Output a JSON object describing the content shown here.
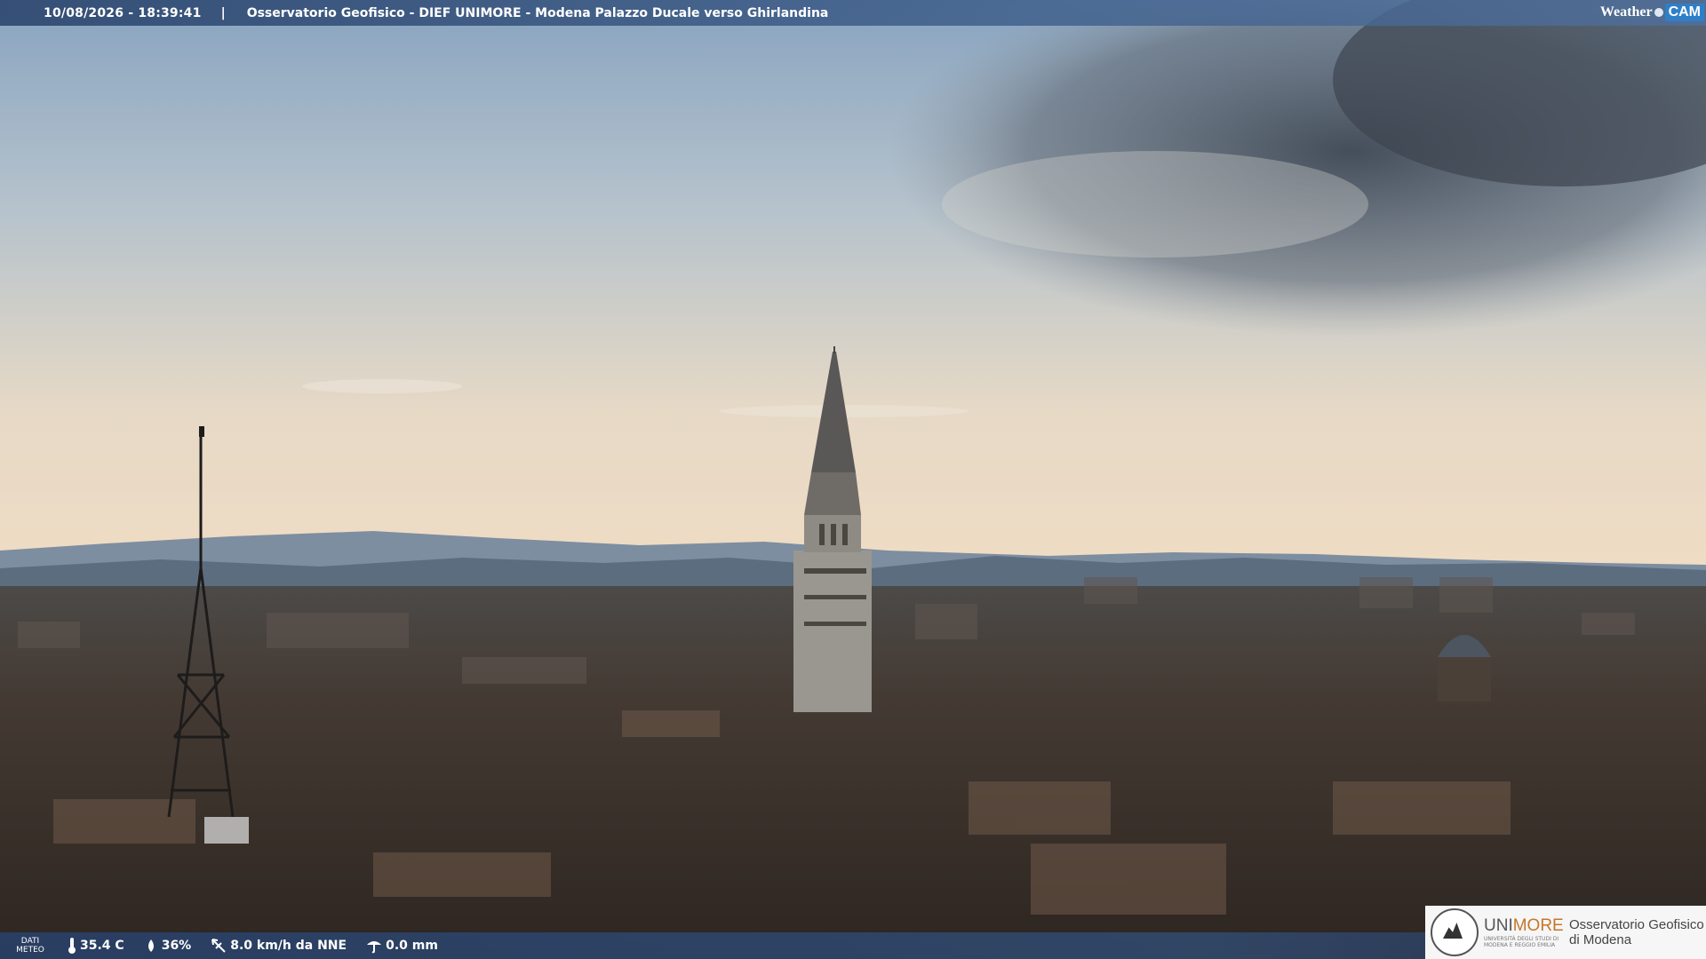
{
  "header": {
    "timestamp": "10/08/2026 - 18:39:41",
    "separator": "|",
    "title": "Osservatorio Geofisico - DIEF UNIMORE - Modena Palazzo Ducale verso Ghirlandina"
  },
  "weathercam_logo": {
    "weather": "Weather",
    "cam": "CAM"
  },
  "weather": {
    "label_line1": "DATI",
    "label_line2": "METEO",
    "temperature": "35.4 C",
    "humidity": "36%",
    "wind": "8.0 km/h da NNE",
    "rain": "0.0 mm"
  },
  "institution": {
    "name_a": "UNI",
    "name_b": "MORE",
    "subtitle": "UNIVERSITÀ DEGLI STUDI DI MODENA E REGGIO EMILIA",
    "observatory_line1": "Osservatorio Geofisico",
    "observatory_line2": "di Modena"
  },
  "colors": {
    "sky_top": "#8fa9c2",
    "sky_horizon": "#efdcc2",
    "cloud": "#4a5360",
    "mountains": "#5d6d80",
    "city": "#3a312b",
    "brand_orange": "#c6762a",
    "bar_blue": "#2e4870"
  }
}
